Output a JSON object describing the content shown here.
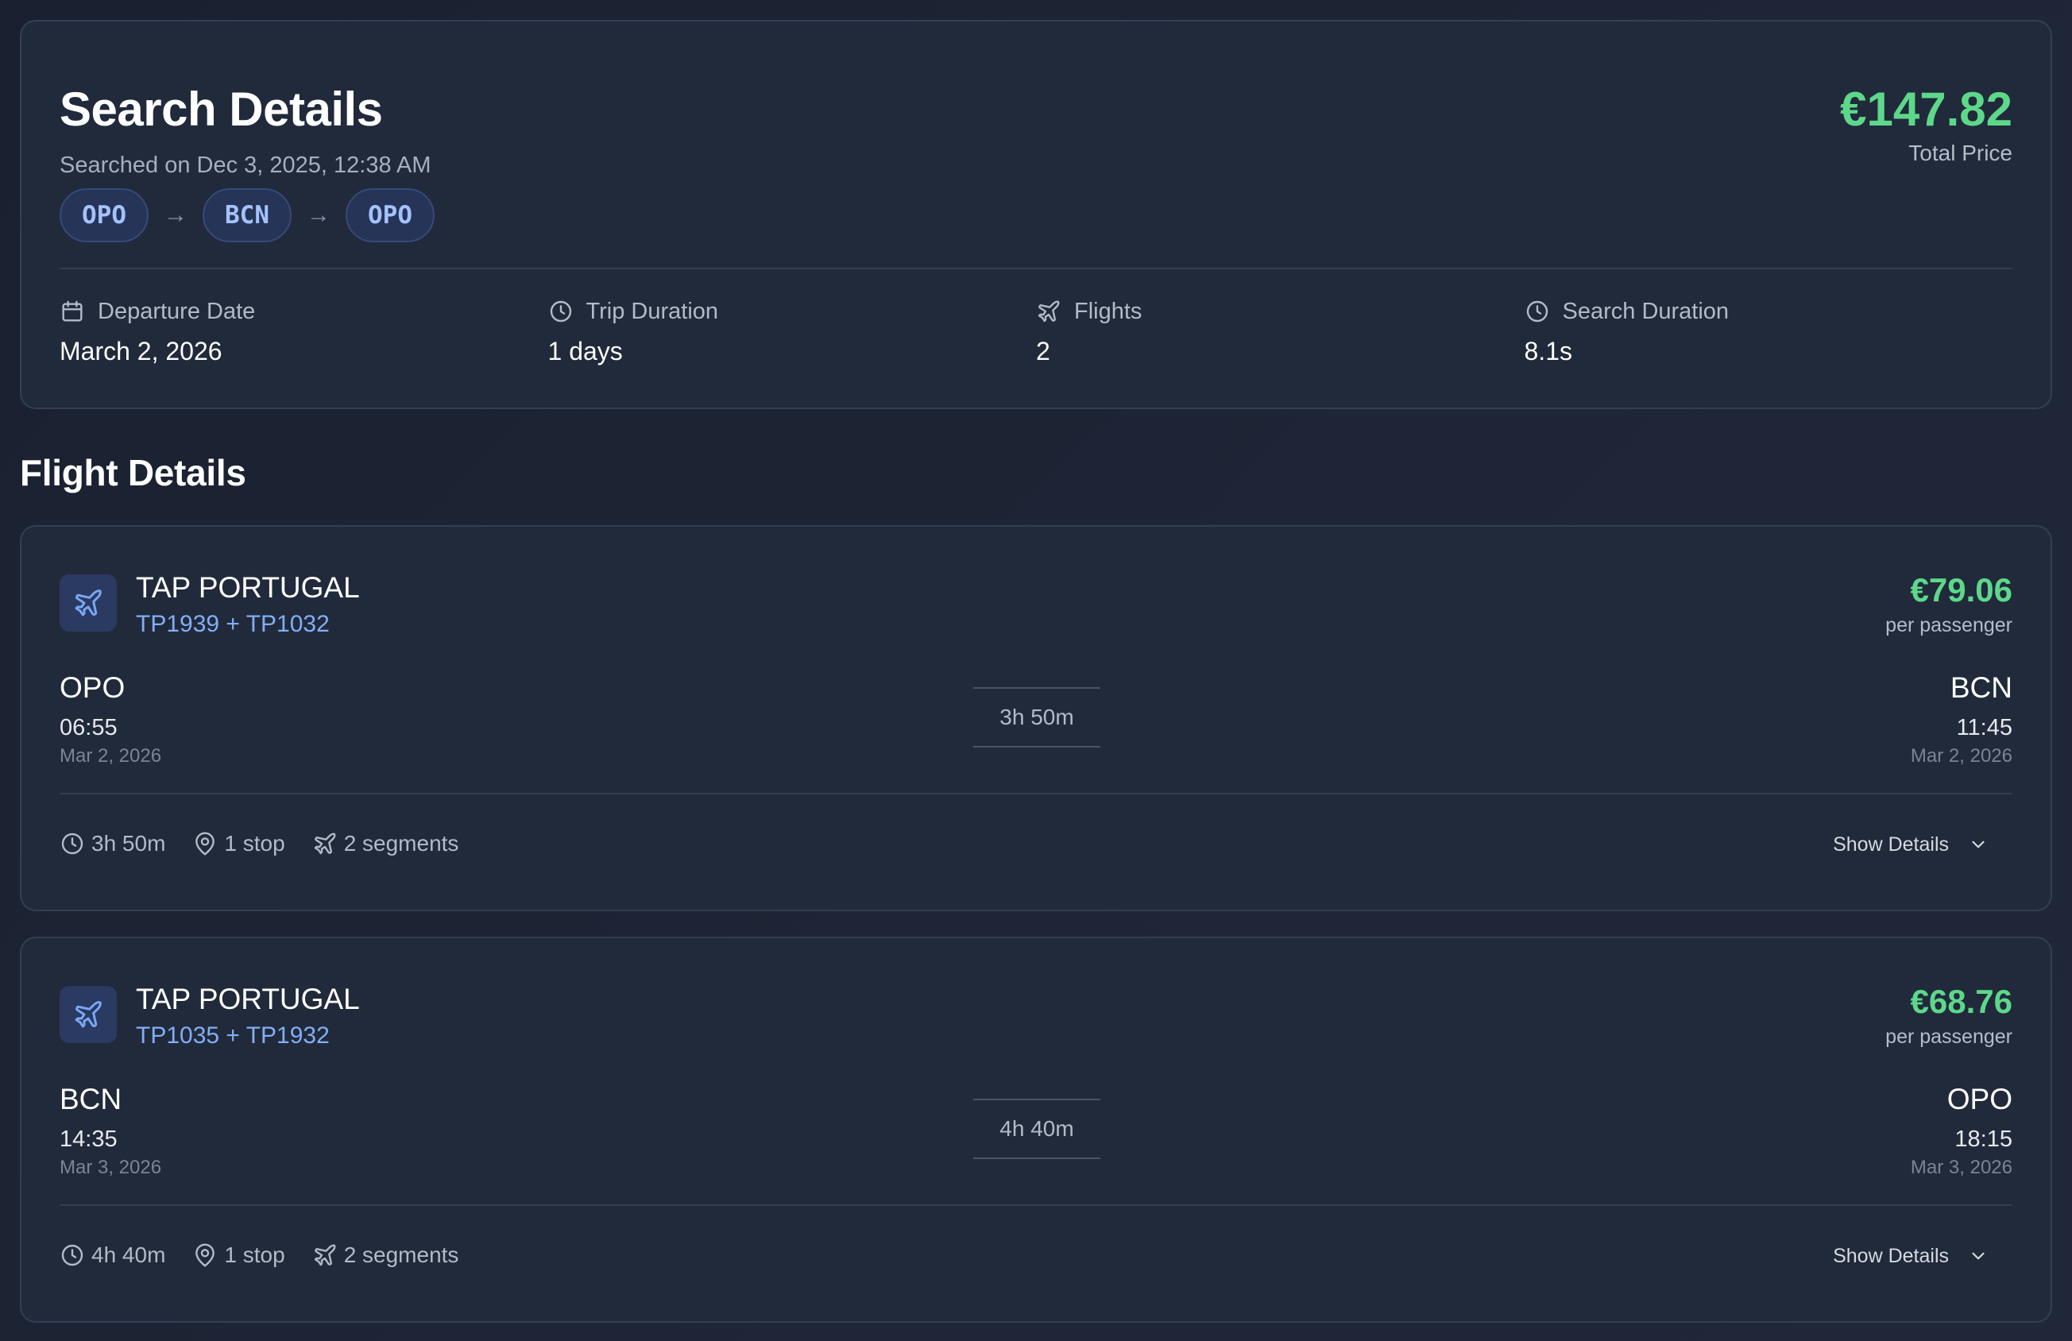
{
  "search": {
    "title": "Search Details",
    "searched_on": "Searched on Dec 3, 2025, 12:38 AM",
    "route": [
      "OPO",
      "BCN",
      "OPO"
    ],
    "total_price": "€147.82",
    "total_price_label": "Total Price",
    "stats": [
      {
        "label": "Departure Date",
        "value": "March 2, 2026",
        "icon": "calendar-icon"
      },
      {
        "label": "Trip Duration",
        "value": "1 days",
        "icon": "clock-icon"
      },
      {
        "label": "Flights",
        "value": "2",
        "icon": "plane-icon"
      },
      {
        "label": "Search Duration",
        "value": "8.1s",
        "icon": "clock-icon"
      }
    ]
  },
  "flight_section_title": "Flight Details",
  "flights": [
    {
      "airline": "TAP PORTUGAL",
      "flight_numbers": "TP1939 + TP1032",
      "price": "€79.06",
      "price_label": "per passenger",
      "from_code": "OPO",
      "from_time": "06:55",
      "from_date": "Mar 2, 2026",
      "to_code": "BCN",
      "to_time": "11:45",
      "to_date": "Mar 2, 2026",
      "duration": "3h 50m",
      "meta_duration": "3h 50m",
      "stops": "1 stop",
      "segments": "2 segments",
      "show_details": "Show Details"
    },
    {
      "airline": "TAP PORTUGAL",
      "flight_numbers": "TP1035 + TP1932",
      "price": "€68.76",
      "price_label": "per passenger",
      "from_code": "BCN",
      "from_time": "14:35",
      "from_date": "Mar 3, 2026",
      "to_code": "OPO",
      "to_time": "18:15",
      "to_date": "Mar 3, 2026",
      "duration": "4h 40m",
      "meta_duration": "4h 40m",
      "stops": "1 stop",
      "segments": "2 segments",
      "show_details": "Show Details"
    }
  ],
  "colors": {
    "accent_green": "#5dd88a",
    "accent_blue": "#82aef5",
    "card_bg": "#212a3b"
  }
}
